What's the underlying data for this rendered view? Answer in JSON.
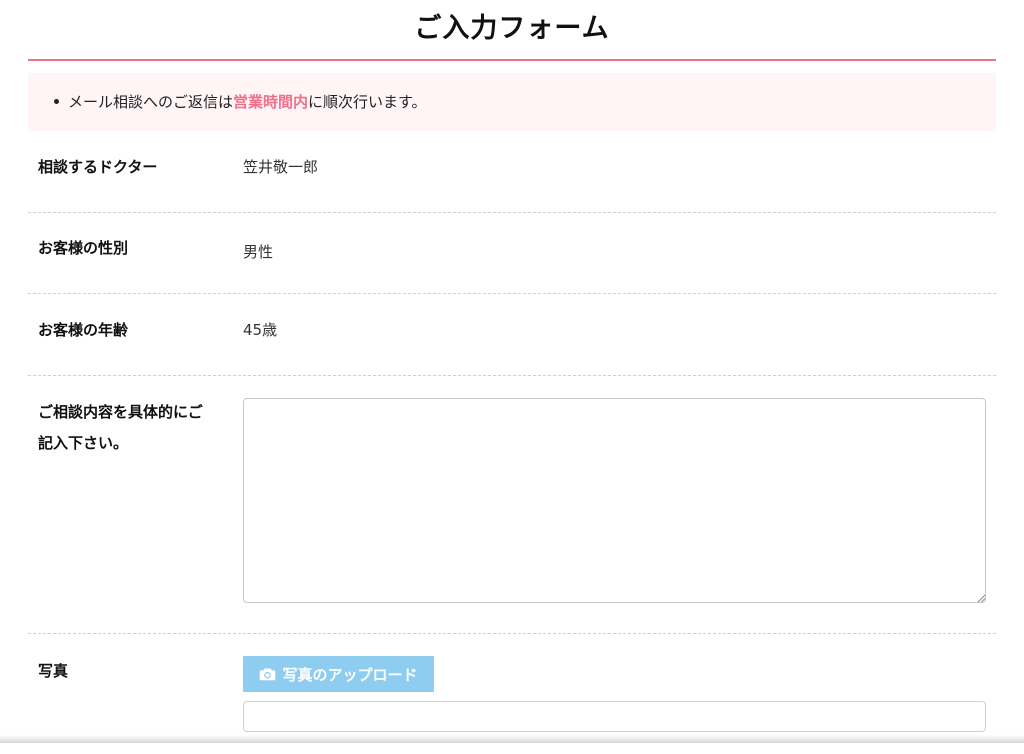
{
  "page": {
    "title": "ご入力フォーム"
  },
  "colors": {
    "accent": "#f07088",
    "notice_bg": "#fff5f7",
    "upload_button_bg": "#8ecdf0"
  },
  "notice": {
    "prefix": "メール相談へのご返信は",
    "highlight": "営業時間内",
    "suffix": "に順次行います。"
  },
  "form": {
    "doctor": {
      "label": "相談するドクター",
      "value": "笠井敬一郎"
    },
    "gender": {
      "label": "お客様の性別",
      "value": "男性"
    },
    "age": {
      "label": "お客様の年齢",
      "value": "45歳"
    },
    "consultation": {
      "label_line1": "ご相談内容を具体的にご",
      "label_line2": "記入下さい。",
      "value": ""
    },
    "photo": {
      "label": "写真",
      "upload_label": "写真のアップロード",
      "upload_icon": "camera-icon",
      "filename_value": ""
    }
  }
}
